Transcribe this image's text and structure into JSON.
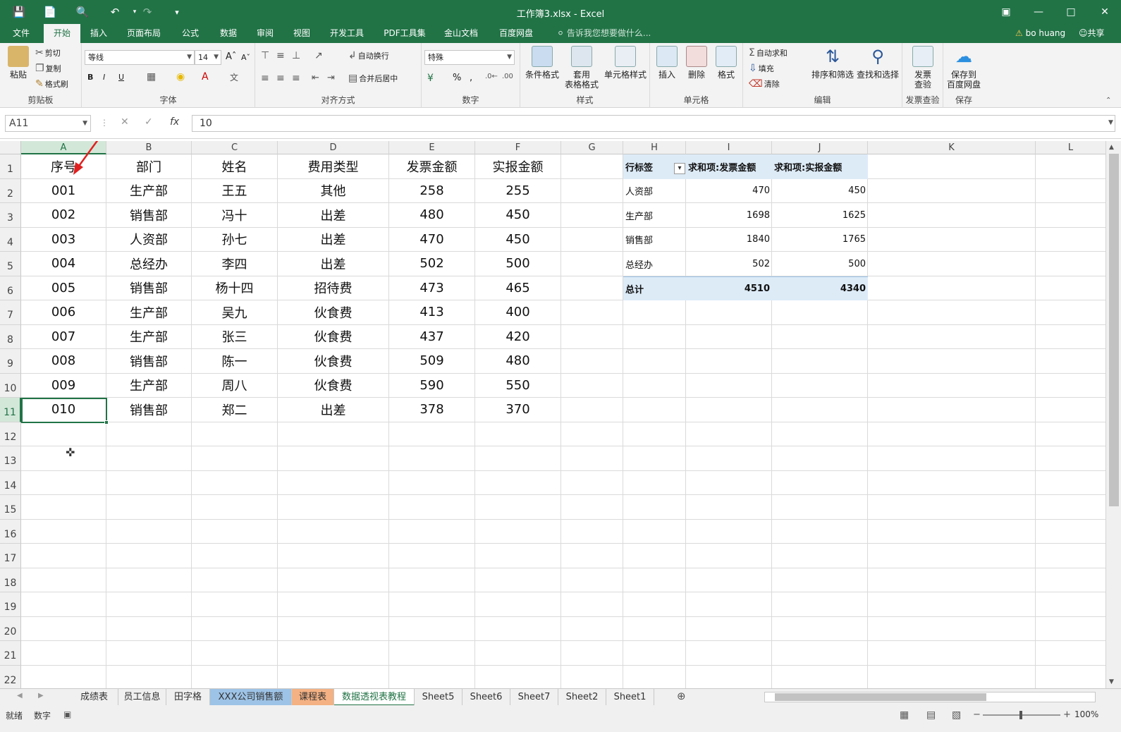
{
  "window": {
    "title": "工作簿3.xlsx - Excel",
    "user": "bo huang",
    "share": "共享"
  },
  "ribbon_tabs": [
    {
      "label": "文件",
      "active": false
    },
    {
      "label": "开始",
      "active": true
    },
    {
      "label": "插入",
      "active": false
    },
    {
      "label": "页面布局",
      "active": false
    },
    {
      "label": "公式",
      "active": false
    },
    {
      "label": "数据",
      "active": false
    },
    {
      "label": "审阅",
      "active": false
    },
    {
      "label": "视图",
      "active": false
    },
    {
      "label": "开发工具",
      "active": false
    },
    {
      "label": "PDF工具集",
      "active": false
    },
    {
      "label": "金山文档",
      "active": false
    },
    {
      "label": "百度网盘",
      "active": false
    }
  ],
  "tell_me": "告诉我您想要做什么...",
  "ribbon": {
    "clipboard": {
      "paste": "粘贴",
      "cut": "剪切",
      "copy": "复制",
      "format_painter": "格式刷",
      "label": "剪贴板"
    },
    "font": {
      "name": "等线",
      "size": "14",
      "bold": "B",
      "italic": "I",
      "underline": "U",
      "label": "字体"
    },
    "align": {
      "wrap": "自动换行",
      "merge": "合并后居中",
      "label": "对齐方式"
    },
    "number": {
      "format": "特殊",
      "percent": "%",
      "comma": ",",
      "label": "数字"
    },
    "styles": {
      "conditional": "条件格式",
      "table_line1": "套用",
      "table_line2": "表格格式",
      "cell_style": "单元格样式",
      "label": "样式"
    },
    "cells": {
      "insert": "插入",
      "delete": "删除",
      "format": "格式",
      "label": "单元格"
    },
    "editing": {
      "autosum": "自动求和",
      "fill": "填充",
      "clear": "清除",
      "sort": "排序和筛选",
      "find": "查找和选择",
      "label": "编辑"
    },
    "invoice": {
      "line1": "发票",
      "line2": "查验",
      "label": "发票查验"
    },
    "save": {
      "line1": "保存到",
      "line2": "百度网盘",
      "label": "保存"
    }
  },
  "formula_bar": {
    "name_box": "A11",
    "value": "10",
    "fx": "fx"
  },
  "columns": [
    "A",
    "B",
    "C",
    "D",
    "E",
    "F",
    "G",
    "H",
    "I",
    "J",
    "K",
    "L"
  ],
  "rows": [
    "1",
    "2",
    "3",
    "4",
    "5",
    "6",
    "7",
    "8",
    "9",
    "10",
    "11",
    "12",
    "13",
    "14",
    "15",
    "16",
    "17",
    "18",
    "19",
    "20",
    "21",
    "22"
  ],
  "table": {
    "headers": [
      "序号",
      "部门",
      "姓名",
      "费用类型",
      "发票金额",
      "实报金额"
    ],
    "rows": [
      [
        "001",
        "生产部",
        "王五",
        "其他",
        "258",
        "255"
      ],
      [
        "002",
        "销售部",
        "冯十",
        "出差",
        "480",
        "450"
      ],
      [
        "003",
        "人资部",
        "孙七",
        "出差",
        "470",
        "450"
      ],
      [
        "004",
        "总经办",
        "李四",
        "出差",
        "502",
        "500"
      ],
      [
        "005",
        "销售部",
        "杨十四",
        "招待费",
        "473",
        "465"
      ],
      [
        "006",
        "生产部",
        "吴九",
        "伙食费",
        "413",
        "400"
      ],
      [
        "007",
        "生产部",
        "张三",
        "伙食费",
        "437",
        "420"
      ],
      [
        "008",
        "销售部",
        "陈一",
        "伙食费",
        "509",
        "480"
      ],
      [
        "009",
        "生产部",
        "周八",
        "伙食费",
        "590",
        "550"
      ],
      [
        "010",
        "销售部",
        "郑二",
        "出差",
        "378",
        "370"
      ]
    ]
  },
  "pivot": {
    "headers": [
      "行标签",
      "求和项:发票金额",
      "求和项:实报金额"
    ],
    "rows": [
      [
        "人资部",
        "470",
        "450"
      ],
      [
        "生产部",
        "1698",
        "1625"
      ],
      [
        "销售部",
        "1840",
        "1765"
      ],
      [
        "总经办",
        "502",
        "500"
      ]
    ],
    "total": [
      "总计",
      "4510",
      "4340"
    ]
  },
  "sheets": [
    {
      "label": "成绩表",
      "color": ""
    },
    {
      "label": "员工信息",
      "color": ""
    },
    {
      "label": "田字格",
      "color": ""
    },
    {
      "label": "XXX公司销售额",
      "color": "#9dc3e6"
    },
    {
      "label": "课程表",
      "color": "#f4b183"
    },
    {
      "label": "数据透视表教程",
      "color": "active"
    },
    {
      "label": "Sheet5",
      "color": ""
    },
    {
      "label": "Sheet6",
      "color": ""
    },
    {
      "label": "Sheet7",
      "color": ""
    },
    {
      "label": "Sheet2",
      "color": ""
    },
    {
      "label": "Sheet1",
      "color": ""
    }
  ],
  "status": {
    "ready": "就绪",
    "num": "数字",
    "zoom": "100%"
  },
  "colors": {
    "accent": "#217346",
    "selection": "#d3e7d9",
    "pivot_header": "#ddebf7"
  }
}
